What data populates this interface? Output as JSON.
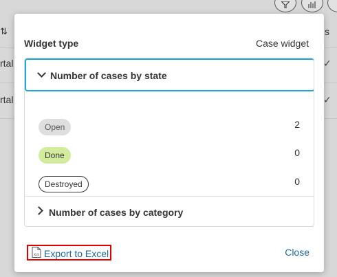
{
  "background": {
    "header_right_label": "s",
    "row_labels": [
      "rtal",
      "rtal"
    ],
    "sort_icon_glyph": "⇅",
    "check_icon_glyph": "✓"
  },
  "dialog": {
    "widget_type_label": "Widget type",
    "widget_type_value": "Case widget",
    "accordion_expanded": {
      "label": "Number of cases by state",
      "rows": [
        {
          "state": "Open",
          "count": "2"
        },
        {
          "state": "Done",
          "count": "0"
        },
        {
          "state": "Destroyed",
          "count": "0"
        }
      ]
    },
    "accordion_collapsed": {
      "label": "Number of cases by category"
    },
    "export_button_label": "Export to Excel",
    "export_icon_text": "XLS",
    "close_button_label": "Close"
  },
  "colors": {
    "accent_link": "#1a6aa0",
    "focus_border": "#1ea7d4",
    "highlight_border": "#e00000",
    "badge_done": "#d3eb9c",
    "badge_open": "#dedede"
  }
}
